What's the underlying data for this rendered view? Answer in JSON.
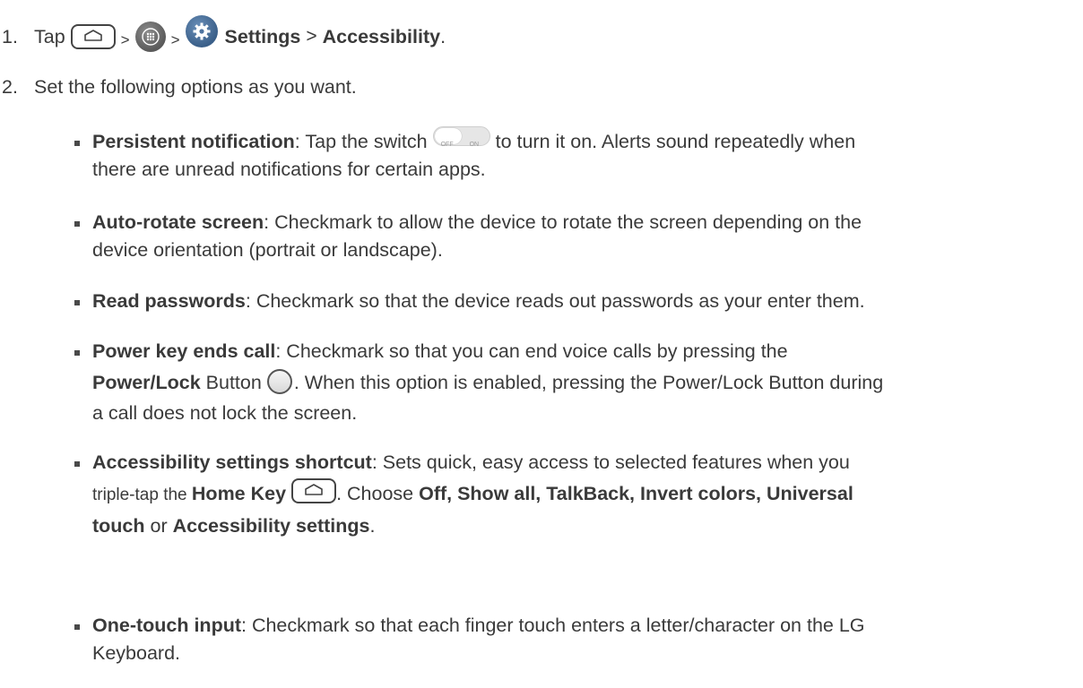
{
  "steps": [
    {
      "number": "1.",
      "prefix": "Tap",
      "sep1": ">",
      "sep2": ">",
      "settings_label": "Settings",
      "sep3": ">",
      "accessibility_label": "Accessibility",
      "period": "."
    },
    {
      "number": "2.",
      "text": "Set the following options as you want."
    }
  ],
  "switch": {
    "off": "OFF",
    "on": "ON"
  },
  "bullets": {
    "persistent": {
      "title": "Persistent notification",
      "text1": ": Tap the switch",
      "text2": "to turn it on. Alerts sound repeatedly when",
      "line2": "there are unread notifications for certain apps."
    },
    "autorotate": {
      "title": "Auto-rotate screen",
      "text1": ": Checkmark to allow the device to rotate the screen depending on the",
      "line2": "device orientation (portrait or landscape)."
    },
    "passwords": {
      "title": "Read passwords",
      "text1": ": Checkmark so that the device reads out passwords as your enter them."
    },
    "powerkey": {
      "title": "Power key ends call",
      "text1": ": Checkmark so that you can end voice calls by pressing the",
      "bold2": "Power/Lock",
      "text2": " Button",
      "text3": ". When this option is enabled, pressing the Power/Lock Button during",
      "line3": "a call does not lock the screen."
    },
    "shortcut": {
      "title": "Accessibility settings shortcut",
      "text1": ": Sets quick, easy access to selected features when you",
      "text2a": "triple-tap the ",
      "bold2": "Home Key",
      "text2b": ". Choose ",
      "bold2b": "Off, Show all, TalkBack, Invert colors, Universal",
      "bold3": "touch",
      "text3": " or ",
      "bold3b": "Accessibility settings",
      "text3b": "."
    },
    "onetouch": {
      "title": "One-touch input",
      "text1": ": Checkmark so that each finger touch enters a letter/character on the LG",
      "line2": "Keyboard."
    }
  }
}
